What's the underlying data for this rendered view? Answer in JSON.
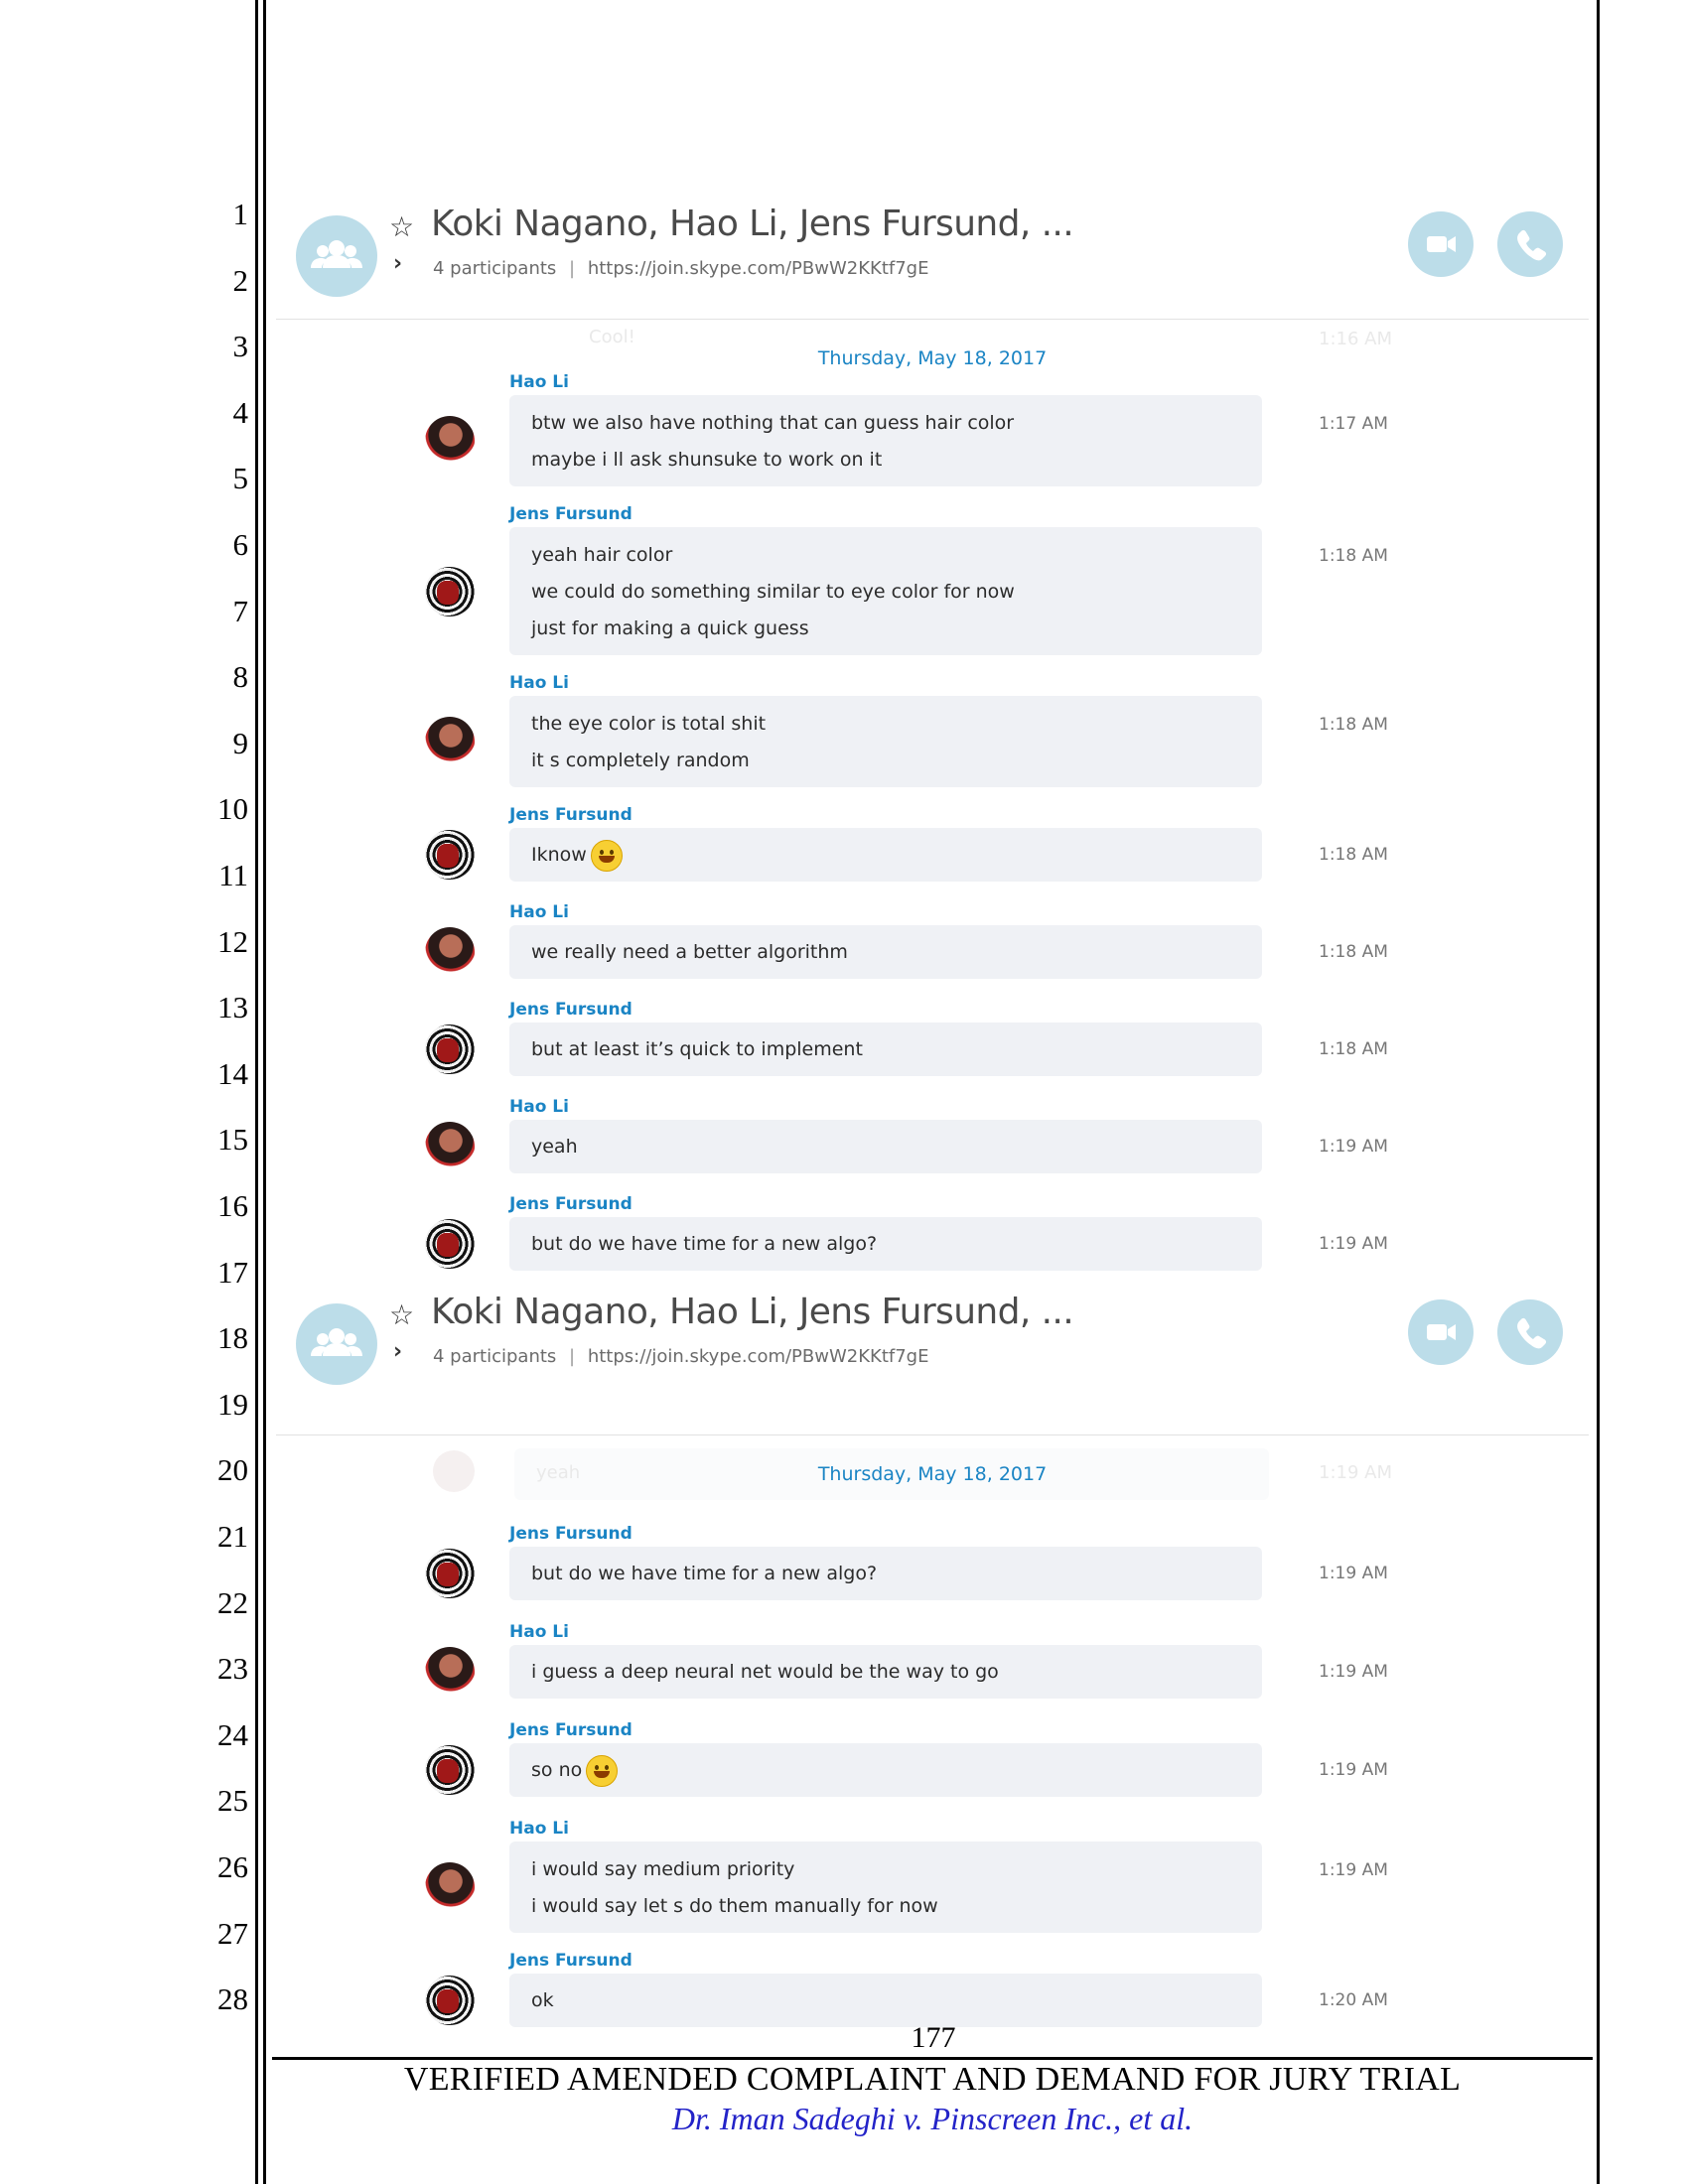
{
  "line_numbers": [
    "1",
    "2",
    "3",
    "4",
    "5",
    "6",
    "7",
    "8",
    "9",
    "10",
    "11",
    "12",
    "13",
    "14",
    "15",
    "16",
    "17",
    "18",
    "19",
    "20",
    "21",
    "22",
    "23",
    "24",
    "25",
    "26",
    "27",
    "28"
  ],
  "screenshots": [
    {
      "title": "Koki Nagano, Hao Li, Jens Fursund, ...",
      "participants": "4 participants",
      "separator": "|",
      "link": "https://join.skype.com/PBwW2KKtf7gE",
      "ghost_text": "Cool!",
      "ghost_time": "1:16 AM",
      "date": "Thursday, May 18, 2017",
      "messages": [
        {
          "sender": "Hao Li",
          "avatar": "hao",
          "lines": [
            "btw we also have nothing that can guess hair color",
            "maybe i ll ask shunsuke to work on it"
          ],
          "time": "1:17 AM"
        },
        {
          "sender": "Jens Fursund",
          "avatar": "jens",
          "lines": [
            "yeah hair color",
            "we could do something similar to eye color for now",
            "just for making a quick guess"
          ],
          "time": "1:18 AM"
        },
        {
          "sender": "Hao Li",
          "avatar": "hao",
          "lines": [
            "the eye color is total shit",
            "it s completely random"
          ],
          "time": "1:18 AM"
        },
        {
          "sender": "Jens Fursund",
          "avatar": "jens",
          "lines": [
            "Iknow"
          ],
          "emoji": "smile-emoji",
          "time": "1:18 AM"
        },
        {
          "sender": "Hao Li",
          "avatar": "hao",
          "lines": [
            "we really need a better algorithm"
          ],
          "time": "1:18 AM"
        },
        {
          "sender": "Jens Fursund",
          "avatar": "jens",
          "lines": [
            "but at least it’s quick to implement"
          ],
          "time": "1:18 AM"
        },
        {
          "sender": "Hao Li",
          "avatar": "hao",
          "lines": [
            "yeah"
          ],
          "time": "1:19 AM"
        },
        {
          "sender": "Jens Fursund",
          "avatar": "jens",
          "lines": [
            "but do we have time for a new algo?"
          ],
          "time": "1:19 AM"
        }
      ]
    },
    {
      "title": "Koki Nagano, Hao Li, Jens Fursund, ...",
      "participants": "4 participants",
      "separator": "|",
      "link": "https://join.skype.com/PBwW2KKtf7gE",
      "ghost_text": "yeah",
      "ghost_time": "1:19 AM",
      "date": "Thursday, May 18, 2017",
      "messages": [
        {
          "sender": "Jens Fursund",
          "avatar": "jens",
          "lines": [
            "but do we have time for a new algo?"
          ],
          "time": "1:19 AM"
        },
        {
          "sender": "Hao Li",
          "avatar": "hao",
          "lines": [
            "i guess a deep neural net would be the way to go"
          ],
          "time": "1:19 AM"
        },
        {
          "sender": "Jens Fursund",
          "avatar": "jens",
          "lines": [
            "so no"
          ],
          "emoji": "grin-emoji",
          "time": "1:19 AM"
        },
        {
          "sender": "Hao Li",
          "avatar": "hao",
          "lines": [
            "i would say medium priority",
            "i would say let s do them manually for now"
          ],
          "time": "1:19 AM"
        },
        {
          "sender": "Jens Fursund",
          "avatar": "jens",
          "lines": [
            "ok"
          ],
          "time": "1:20 AM"
        }
      ]
    }
  ],
  "footer": {
    "page_number": "177",
    "title": "VERIFIED AMENDED COMPLAINT AND DEMAND FOR JURY TRIAL",
    "case": "Dr. Iman Sadeghi v. Pinscreen Inc., et al."
  }
}
